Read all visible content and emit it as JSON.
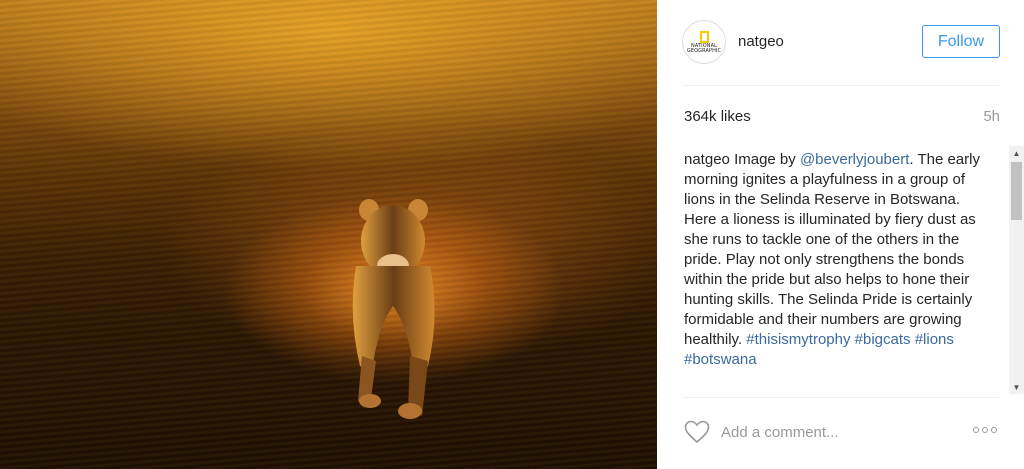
{
  "post": {
    "image_alt": "lioness running through fiery dust at sunrise"
  },
  "header": {
    "username": "natgeo",
    "avatar_logo_lines": [
      "NATIONAL",
      "GEOGRAPHIC"
    ],
    "follow_label": "Follow"
  },
  "stats": {
    "likes": "364k likes",
    "time_ago": "5h"
  },
  "caption": {
    "user": "natgeo",
    "text_before_mention": "Image by ",
    "mention": "@beverlyjoubert",
    "text_after_mention": ". The early morning ignites a playfulness in a group of lions in the Selinda Reserve in Botswana. Here a lioness is illuminated by fiery dust as she runs to tackle one of the others in the pride. Play not only strengthens the bonds within the pride but also helps to hone their hunting skills. The Selinda Pride is certainly formidable and their numbers are growing healthily. ",
    "hashtags": [
      "#thisismytrophy",
      "#bigcats",
      "#lions",
      "#botswana"
    ]
  },
  "comment": {
    "placeholder": "Add a comment..."
  },
  "colors": {
    "link": "#3b6a9c",
    "follow_blue": "#3897f0",
    "secondary_text": "#999999"
  }
}
